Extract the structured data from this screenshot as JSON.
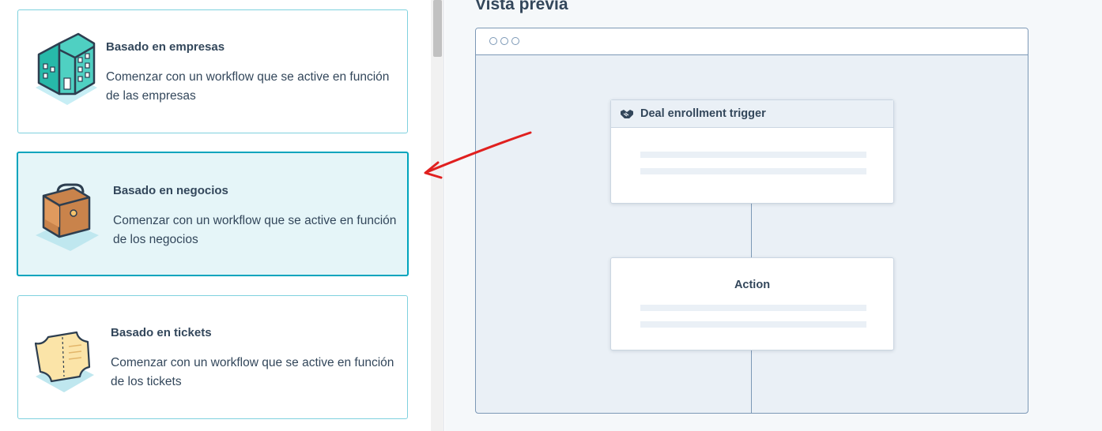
{
  "cards": [
    {
      "title": "Basado en empresas",
      "description": "Comenzar con un workflow que se active en función de las empresas",
      "icon": "building-icon",
      "selected": false
    },
    {
      "title": "Basado en negocios",
      "description": "Comenzar con un workflow que se active en función de los negocios",
      "icon": "briefcase-icon",
      "selected": true
    },
    {
      "title": "Basado en tickets",
      "description": "Comenzar con un workflow que se active en función de los tickets",
      "icon": "ticket-icon",
      "selected": false
    }
  ],
  "preview": {
    "title": "Vista previa",
    "trigger_label": "Deal enrollment trigger",
    "trigger_icon": "handshake-icon",
    "action_label": "Action"
  },
  "annotation": {
    "arrow_color": "#e0201f"
  },
  "colors": {
    "accent": "#00a4bd",
    "selected_bg": "#e5f5f8",
    "text": "#33475b"
  }
}
